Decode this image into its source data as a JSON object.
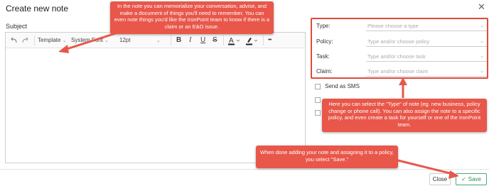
{
  "dialog": {
    "title": "Create new note"
  },
  "editor": {
    "subject_label": "Subject",
    "toolbar": {
      "template_label": "Template",
      "font_label": "System Font",
      "size_label": "12pt",
      "bold": "B",
      "italic": "I",
      "underline": "U",
      "strike": "S",
      "more": "•••"
    }
  },
  "fields": [
    {
      "label": "Type:",
      "placeholder": "Please choose a type"
    },
    {
      "label": "Policy:",
      "placeholder": "Type and/or choose policy"
    },
    {
      "label": "Task:",
      "placeholder": "Type and/or choose task"
    },
    {
      "label": "Claim:",
      "placeholder": "Type and/or choose claim"
    }
  ],
  "options": {
    "send_sms_label": "Send as SMS"
  },
  "footer": {
    "close_label": "Close",
    "save_label": "Save"
  },
  "annotations": {
    "note_callout": "In the note you can memorialize your conversation, advise, and make a document of things you'll need to remember. You can even note things you'd like the IronPoint team to know if there is a claim or an E&O issue.",
    "type_callout": "Here you can select the \"Type\" of note (eg. new business, policy change or phone call). You can also assign the note to a specific policy, and even create a task for yourself or one of the IronPoint team.",
    "save_callout": "When done adding your note and assigning it to a policy, you select \"Save.\""
  },
  "colors": {
    "callout": "#e8574a",
    "save": "#2e8a57"
  }
}
